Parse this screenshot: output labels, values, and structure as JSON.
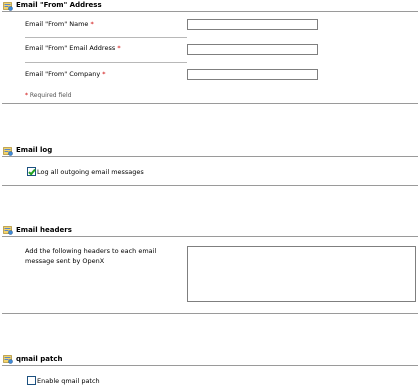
{
  "sections": {
    "email_from": {
      "title": "Email \"From\" Address",
      "fields": [
        {
          "label": "Email \"From\" Name",
          "value": ""
        },
        {
          "label": "Email \"From\" Email Address",
          "value": ""
        },
        {
          "label": "Email \"From\" Company",
          "value": ""
        }
      ],
      "required_marker": "*",
      "required_note": "* Required field"
    },
    "email_log": {
      "title": "Email log",
      "checkbox_label": "Log all outgoing email messages",
      "checked": true
    },
    "email_headers": {
      "title": "Email headers",
      "description": "Add the following headers to each email message sent by OpenX",
      "value": ""
    },
    "qmail_patch": {
      "title": "qmail patch",
      "checkbox_label": "Enable qmail patch",
      "checked": false
    }
  },
  "icons": {
    "section_icon": "settings-section-icon"
  },
  "colors": {
    "required": "#cc0000",
    "divider": "#9a9a9a",
    "check": "#21a121"
  }
}
